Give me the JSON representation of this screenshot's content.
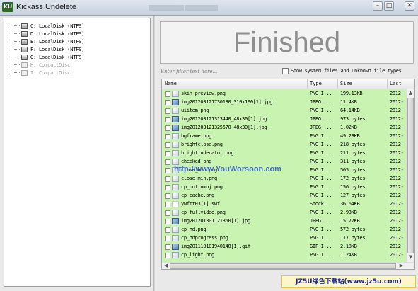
{
  "window": {
    "title": "Kickass Undelete",
    "app_icon_text": "KU",
    "controls": [
      "–",
      "□",
      "✕"
    ]
  },
  "drives": [
    {
      "label": "C: LocalDisk (NTFS)",
      "enabled": true
    },
    {
      "label": "D: LocalDisk (NTFS)",
      "enabled": true
    },
    {
      "label": "E: LocalDisk (NTFS)",
      "enabled": true
    },
    {
      "label": "F: LocalDisk (NTFS)",
      "enabled": true
    },
    {
      "label": "G: LocalDisk (NTFS)",
      "enabled": true
    },
    {
      "label": "H: CompactDisc",
      "enabled": false
    },
    {
      "label": "I: CompactDisc",
      "enabled": false
    }
  ],
  "status": "Finished",
  "filter": {
    "placeholder": "Enter filter text here...",
    "value": ""
  },
  "show_system": {
    "label": "Show system files and unknown file types",
    "checked": false
  },
  "columns": {
    "name": "Name",
    "type": "Type",
    "size": "Size",
    "last": "Last"
  },
  "files": [
    {
      "name": "skin_preview.png",
      "type": "PNG I...",
      "size": "199.13KB",
      "date": "2012-",
      "icon": "png"
    },
    {
      "name": "img201203121730180_310x190[1].jpg",
      "type": "JPEG ...",
      "size": "11.4KB",
      "date": "2012-",
      "icon": "jpg"
    },
    {
      "name": "uiitem.png",
      "type": "PNG I...",
      "size": "64.14KB",
      "date": "2012-",
      "icon": "png"
    },
    {
      "name": "img201203121313440_48x30[1].jpg",
      "type": "JPEG ...",
      "size": "973 bytes",
      "date": "2012-",
      "icon": "jpg"
    },
    {
      "name": "img201203121325570_48x30[1].jpg",
      "type": "JPEG ...",
      "size": "1.02KB",
      "date": "2012-",
      "icon": "jpg"
    },
    {
      "name": "bgframe.png",
      "type": "PNG I...",
      "size": "49.23KB",
      "date": "2012-",
      "icon": "png"
    },
    {
      "name": "brightclose.png",
      "type": "PNG I...",
      "size": "218 bytes",
      "date": "2012-",
      "icon": "png"
    },
    {
      "name": "brightindecator.png",
      "type": "PNG I...",
      "size": "211 bytes",
      "date": "2012-",
      "icon": "png"
    },
    {
      "name": "checked.png",
      "type": "PNG I...",
      "size": "311 bytes",
      "date": "2012-",
      "icon": "png"
    },
    {
      "name": "close_btn.png",
      "type": "PNG I...",
      "size": "505 bytes",
      "date": "2012-",
      "icon": "png"
    },
    {
      "name": "close_min.png",
      "type": "PNG I...",
      "size": "172 bytes",
      "date": "2012-",
      "icon": "png"
    },
    {
      "name": "cp_bottombj.png",
      "type": "PNG I...",
      "size": "156 bytes",
      "date": "2012-",
      "icon": "png"
    },
    {
      "name": "cp_cache.png",
      "type": "PNG I...",
      "size": "127 bytes",
      "date": "2012-",
      "icon": "png"
    },
    {
      "name": "ywfmt03[1].swf",
      "type": "Shock...",
      "size": "36.64KB",
      "date": "2012-",
      "icon": "swf"
    },
    {
      "name": "cp_fullvideo.png",
      "type": "PNG I...",
      "size": "2.93KB",
      "date": "2012-",
      "icon": "png"
    },
    {
      "name": "img201201301121360[1].jpg",
      "type": "JPEG ...",
      "size": "15.77KB",
      "date": "2012-",
      "icon": "jpg"
    },
    {
      "name": "cp_hd.png",
      "type": "PNG I...",
      "size": "572 bytes",
      "date": "2012-",
      "icon": "png"
    },
    {
      "name": "cp_hdprogress.png",
      "type": "PNG I...",
      "size": "117 bytes",
      "date": "2012-",
      "icon": "png"
    },
    {
      "name": "img20111010194014O[1].gif",
      "type": "GIF I...",
      "size": "2.18KB",
      "date": "2012-",
      "icon": "jpg"
    },
    {
      "name": "cp_light.png",
      "type": "PNG I...",
      "size": "1.24KB",
      "date": "2012-",
      "icon": "png"
    }
  ],
  "watermark": "http://www.YouWorsoon.com",
  "banner": "JZ5U绿色下载站(www.jz5u.com)"
}
